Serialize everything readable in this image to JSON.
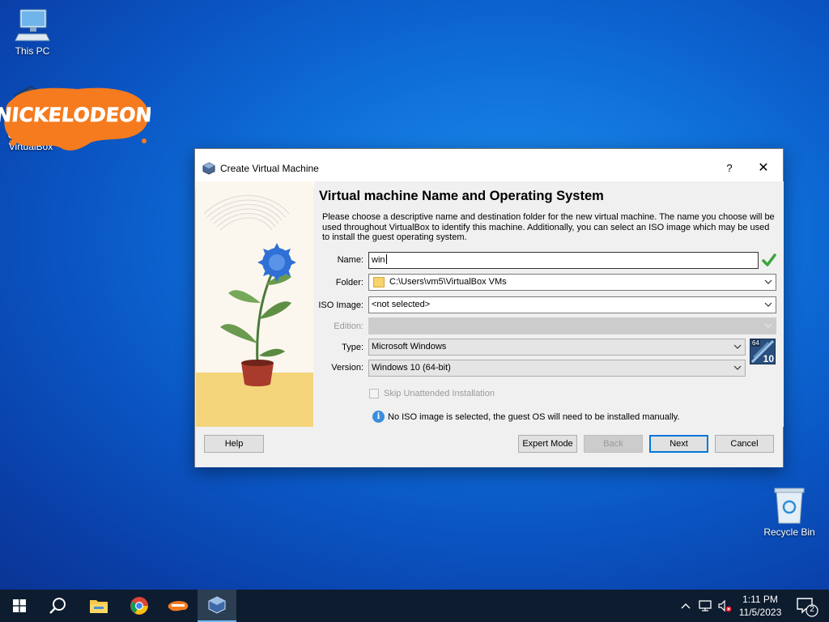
{
  "desktop": {
    "icons": [
      {
        "label": "This PC"
      },
      {
        "label": "Oracle VM VirtualBox"
      },
      {
        "label": "Recycle Bin"
      }
    ],
    "overlay_logo_text": "NICKELODEON"
  },
  "dialog": {
    "title": "Create Virtual Machine",
    "help_glyph": "?",
    "close_glyph": "✕",
    "heading": "Virtual machine Name and Operating System",
    "description": "Please choose a descriptive name and destination folder for the new virtual machine. The name you choose will be used throughout VirtualBox to identify this machine. Additionally, you can select an ISO image which may be used to install the guest operating system.",
    "fields": {
      "name_label": "Name:",
      "name_value": "win",
      "folder_label": "Folder:",
      "folder_value": "C:\\Users\\vm5\\VirtualBox VMs",
      "iso_label": "ISO Image:",
      "iso_value": "<not selected>",
      "edition_label": "Edition:",
      "edition_value": "",
      "type_label": "Type:",
      "type_value": "Microsoft Windows",
      "version_label": "Version:",
      "version_value": "Windows 10 (64-bit)",
      "os_badge_top": "64",
      "os_badge_num": "10"
    },
    "skip_unattended_label": "Skip Unattended Installation",
    "info_text": "No ISO image is selected, the guest OS will need to be installed manually.",
    "buttons": {
      "help": "Help",
      "expert": "Expert Mode",
      "back": "Back",
      "next": "Next",
      "cancel": "Cancel"
    }
  },
  "taskbar": {
    "time": "1:11 PM",
    "date": "11/5/2023",
    "notification_count": "2",
    "apps": [
      "start",
      "search",
      "file-explorer",
      "chrome",
      "nickelodeon-app",
      "virtualbox"
    ]
  },
  "colors": {
    "desktop_blue": "#0f6fd8",
    "accent": "#0078d7",
    "taskbar": "#0d1c2e",
    "valid_check": "#3aa53a"
  }
}
